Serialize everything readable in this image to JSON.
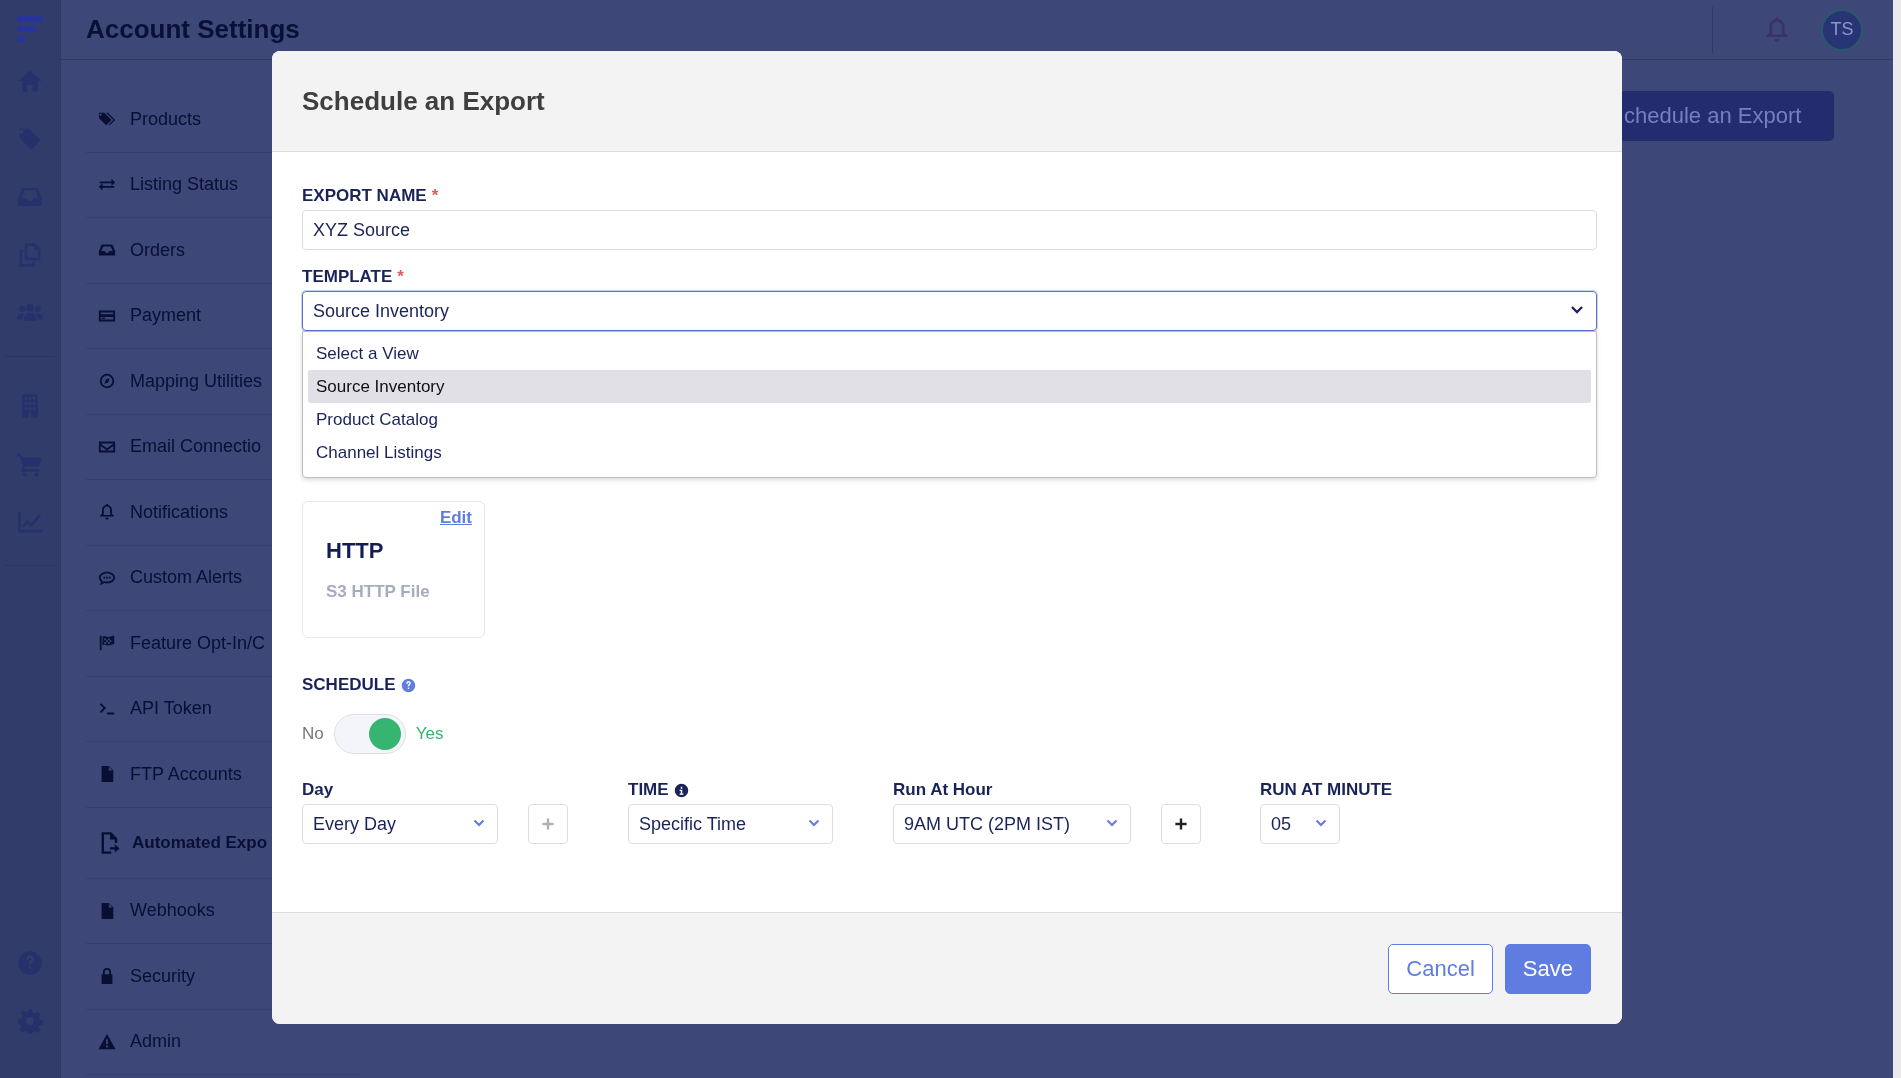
{
  "header": {
    "title": "Account Settings",
    "avatar": "TS",
    "action_button": "chedule an Export"
  },
  "nav": {
    "items": [
      {
        "label": "Products",
        "selected": false
      },
      {
        "label": "Listing Status",
        "selected": false
      },
      {
        "label": "Orders",
        "selected": false
      },
      {
        "label": "Payment",
        "selected": false
      },
      {
        "label": "Mapping Utilities",
        "selected": false
      },
      {
        "label": "Email Connectio",
        "selected": false
      },
      {
        "label": "Notifications",
        "selected": false
      },
      {
        "label": "Custom Alerts",
        "selected": false
      },
      {
        "label": "Feature Opt-In/C",
        "selected": false
      },
      {
        "label": "API Token",
        "selected": false
      },
      {
        "label": "FTP Accounts",
        "selected": false
      },
      {
        "label": "Automated Expo",
        "selected": true
      },
      {
        "label": "Webhooks",
        "selected": false
      },
      {
        "label": "Security",
        "selected": false
      },
      {
        "label": "Admin",
        "selected": false
      }
    ]
  },
  "modal": {
    "title": "Schedule an Export",
    "fields": [
      {
        "kind": "text",
        "label": "EXPORT NAME",
        "required_mark": "*",
        "value": "XYZ Source"
      },
      {
        "kind": "select",
        "label": "TEMPLATE",
        "required_mark": "*",
        "value": "Source Inventory",
        "expanded": true,
        "options": [
          {
            "label": "Select a View",
            "selected": false
          },
          {
            "label": "Source Inventory",
            "selected": true
          },
          {
            "label": "Product Catalog",
            "selected": false
          },
          {
            "label": "Channel Listings",
            "selected": false
          }
        ]
      }
    ],
    "destination": {
      "link": "Edit",
      "title": "HTTP",
      "subtitle": "S3 HTTP File"
    },
    "schedule": {
      "label": "SCHEDULE",
      "help_icon": true,
      "off_label": "No",
      "on_label": "Yes",
      "on": true
    },
    "schedule_fields": [
      {
        "label": "Day",
        "value": "Every Day",
        "add": {
          "disabled": true
        }
      },
      {
        "label": "TIME",
        "info_icon": true,
        "value": "Specific Time"
      },
      {
        "label": "Run At Hour",
        "value": "9AM UTC (2PM IST)",
        "add": {
          "disabled": false
        }
      },
      {
        "label": "RUN AT MINUTE",
        "value": "05"
      }
    ],
    "buttons": [
      {
        "label": "Cancel",
        "kind": "secondary"
      },
      {
        "label": "Save",
        "kind": "primary"
      }
    ]
  }
}
